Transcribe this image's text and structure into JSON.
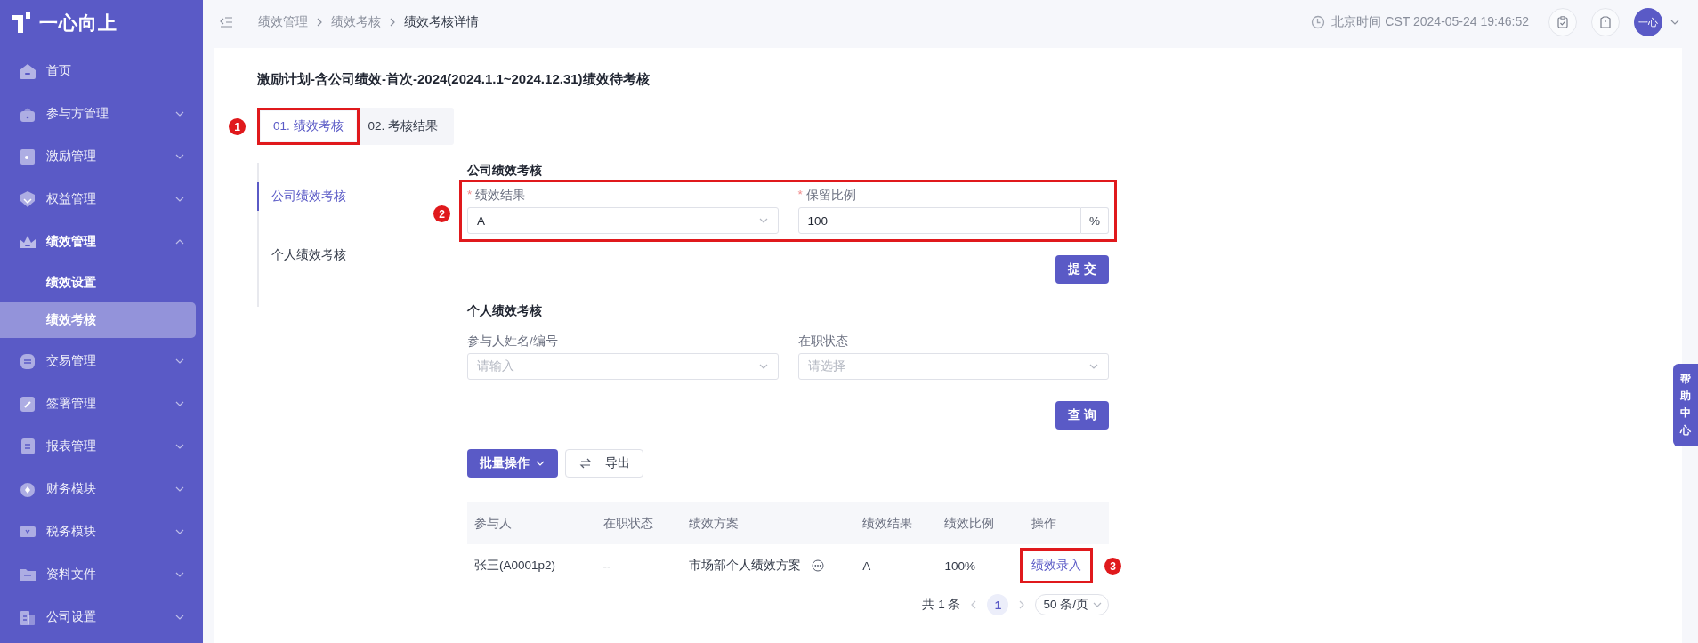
{
  "sidebar": {
    "logo": "一心向上",
    "items": [
      {
        "label": "首页",
        "kind": "link",
        "expanded": false
      },
      {
        "label": "参与方管理",
        "kind": "group",
        "expanded": false
      },
      {
        "label": "激励管理",
        "kind": "group",
        "expanded": false
      },
      {
        "label": "权益管理",
        "kind": "group",
        "expanded": false
      },
      {
        "label": "绩效管理",
        "kind": "group",
        "expanded": true,
        "children": [
          {
            "label": "绩效设置",
            "selected": false
          },
          {
            "label": "绩效考核",
            "selected": true
          }
        ]
      },
      {
        "label": "交易管理",
        "kind": "group",
        "expanded": false
      },
      {
        "label": "签署管理",
        "kind": "group",
        "expanded": false
      },
      {
        "label": "报表管理",
        "kind": "group",
        "expanded": false
      },
      {
        "label": "财务模块",
        "kind": "group",
        "expanded": false
      },
      {
        "label": "税务模块",
        "kind": "group",
        "expanded": false
      },
      {
        "label": "资料文件",
        "kind": "group",
        "expanded": false
      },
      {
        "label": "公司设置",
        "kind": "group",
        "expanded": false
      }
    ]
  },
  "header": {
    "breadcrumbs": [
      "绩效管理",
      "绩效考核",
      "绩效考核详情"
    ],
    "time": "北京时间 CST 2024-05-24 19:46:52",
    "avatar": "一心"
  },
  "page": {
    "title": "激励计划-含公司绩效-首次-2024(2024.1.1~2024.12.31)绩效待考核",
    "tabs": [
      {
        "label": "01. 绩效考核",
        "selected": true,
        "callout": "1"
      },
      {
        "label": "02. 考核结果",
        "selected": false
      }
    ],
    "side_nav": [
      {
        "label": "公司绩效考核",
        "selected": true
      },
      {
        "label": "个人绩效考核",
        "selected": false
      }
    ],
    "company_section": {
      "heading": "公司绩效考核",
      "callout": "2",
      "fields": [
        {
          "label": "绩效结果",
          "required_mark": "*",
          "kind": "select",
          "value": "A"
        },
        {
          "label": "保留比例",
          "required_mark": "*",
          "kind": "suffix",
          "value": "100",
          "suffix": "%"
        }
      ],
      "submit": "提 交"
    },
    "personal_section": {
      "heading": "个人绩效考核",
      "filters": [
        {
          "label": "参与人姓名/编号",
          "kind": "select",
          "placeholder": "请输入"
        },
        {
          "label": "在职状态",
          "kind": "select",
          "placeholder": "请选择"
        }
      ],
      "query": "查 询",
      "batch": "批量操作",
      "export": "导出",
      "table": {
        "columns": [
          "参与人",
          "在职状态",
          "绩效方案",
          "绩效结果",
          "绩效比例",
          "操作"
        ],
        "rows": [
          {
            "cells": [
              "张三(A0001p2)",
              "--",
              "市场部个人绩效方案",
              "A",
              "100%"
            ],
            "action": "绩效录入",
            "callout": "3"
          }
        ]
      },
      "pagination": {
        "total": "共 1 条",
        "pages": [
          {
            "label": "1",
            "selected": true
          }
        ],
        "page_size": "50 条/页"
      }
    }
  },
  "help": "帮助中心"
}
